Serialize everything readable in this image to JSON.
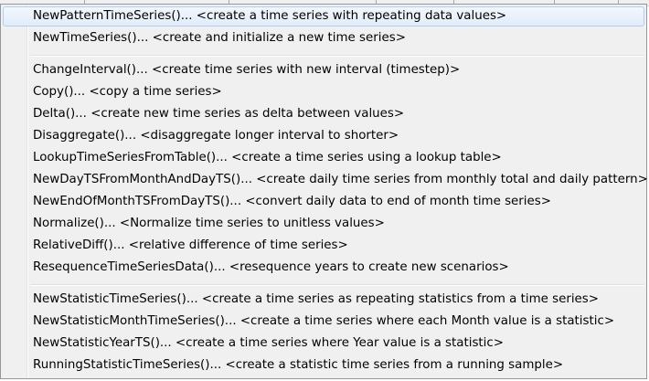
{
  "menu": {
    "groups": [
      {
        "items": [
          {
            "label": "NewPatternTimeSeries()... <create a time series with repeating data values>"
          },
          {
            "label": "NewTimeSeries()... <create and initialize a new time series>"
          }
        ]
      },
      {
        "items": [
          {
            "label": "ChangeInterval()... <create time series with new interval (timestep)>"
          },
          {
            "label": "Copy()... <copy a time series>"
          },
          {
            "label": "Delta()... <create new time series as delta between values>"
          },
          {
            "label": "Disaggregate()... <disaggregate longer interval to shorter>"
          },
          {
            "label": "LookupTimeSeriesFromTable()... <create a time series using a lookup table>"
          },
          {
            "label": "NewDayTSFromMonthAndDayTS()... <create daily time series from monthly total and daily pattern>"
          },
          {
            "label": "NewEndOfMonthTSFromDayTS()... <convert daily data to end of month time series>"
          },
          {
            "label": "Normalize()... <Normalize time series to unitless values>"
          },
          {
            "label": "RelativeDiff()... <relative difference of time series>"
          },
          {
            "label": "ResequenceTimeSeriesData()... <resequence years to create new scenarios>"
          }
        ]
      },
      {
        "items": [
          {
            "label": "NewStatisticTimeSeries()... <create a time series as repeating statistics from a time series>"
          },
          {
            "label": "NewStatisticMonthTimeSeries()... <create a time series where each Month value is a statistic>"
          },
          {
            "label": "NewStatisticYearTS()... <create a time series where Year value is a statistic>"
          },
          {
            "label": "RunningStatisticTimeSeries()... <create a statistic time series from a running sample>"
          }
        ]
      }
    ],
    "highlighted_item": "NewPatternTimeSeries()... <create a time series with repeating data values>"
  },
  "colors": {
    "menu_background": "#f0f0f0",
    "highlight_border": "#aecff7",
    "highlight_fill": "#e1ecf9",
    "text": "#000000"
  }
}
